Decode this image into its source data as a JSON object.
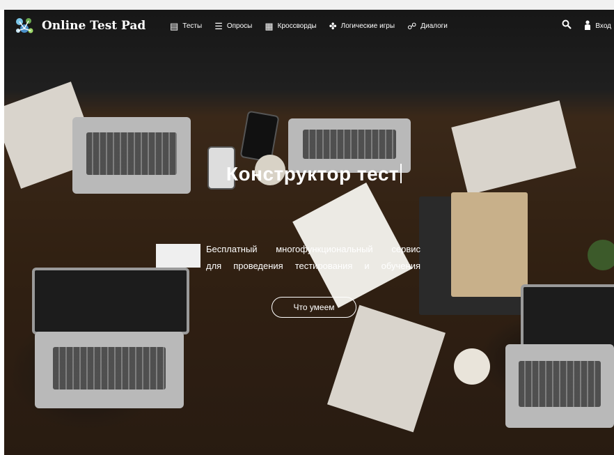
{
  "brand": {
    "name": "Online Test Pad",
    "icon": "logo-molecule-icon"
  },
  "nav": {
    "items": [
      {
        "label": "Тесты",
        "icon": "test-sheet-icon"
      },
      {
        "label": "Опросы",
        "icon": "survey-icon"
      },
      {
        "label": "Кроссворды",
        "icon": "crossword-icon"
      },
      {
        "label": "Логические игры",
        "icon": "puzzle-icon"
      },
      {
        "label": "Диалоги",
        "icon": "dialog-icon"
      }
    ],
    "search_icon": "search-icon",
    "login_label": "Вход",
    "login_icon": "user-icon"
  },
  "hero": {
    "headline": "Конструктор тест",
    "subtitle_line1": "Бесплатный многофункциональный сервис",
    "subtitle_line2": "для проведения тестирования и обучения",
    "cta_label": "Что умеем"
  },
  "colors": {
    "text": "#ffffff",
    "overlay": "#000000"
  }
}
